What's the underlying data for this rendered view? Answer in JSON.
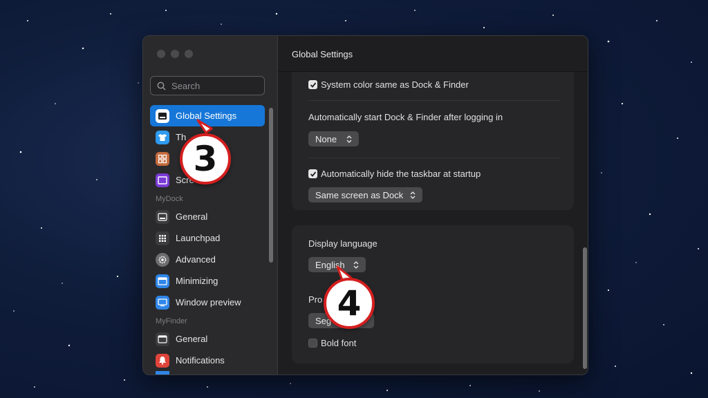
{
  "window": {
    "title": "Global Settings"
  },
  "search": {
    "placeholder": "Search"
  },
  "sidebar": {
    "items_top": [
      {
        "label": "Global Settings",
        "icon": "display-icon",
        "color": "#ffffff",
        "active": true
      },
      {
        "label": "Th",
        "icon": "tshirt-icon",
        "color": "#2f9bf0"
      },
      {
        "label": "",
        "icon": "grid-icon",
        "color": "#c46a3c"
      },
      {
        "label": "Scre",
        "icon": "screen-icon",
        "color": "#7a3ad6"
      }
    ],
    "section_mydock": "MyDock",
    "items_mydock": [
      {
        "label": "General",
        "icon": "dock-icon",
        "color": "#3c3c3e"
      },
      {
        "label": "Launchpad",
        "icon": "launchpad-icon",
        "color": "#3c3c3e"
      },
      {
        "label": "Advanced",
        "icon": "gear-icon",
        "color": "#6e6e70"
      },
      {
        "label": "Minimizing",
        "icon": "minimize-icon",
        "color": "#2f86e8"
      },
      {
        "label": "Window preview",
        "icon": "preview-icon",
        "color": "#2f86e8"
      }
    ],
    "section_myfinder": "MyFinder",
    "items_myfinder": [
      {
        "label": "General",
        "icon": "finder-general-icon",
        "color": "#3c3c3e"
      },
      {
        "label": "Notifications",
        "icon": "bell-icon",
        "color": "#e0443a"
      }
    ]
  },
  "settings": {
    "system_color_label": "System color same as Dock & Finder",
    "system_color_checked": true,
    "autostart_label": "Automatically start Dock & Finder after logging in",
    "autostart_value": "None",
    "autohide_label": "Automatically hide the taskbar at startup",
    "autohide_checked": true,
    "autohide_screen_value": "Same screen as Dock",
    "display_language_label": "Display language",
    "display_language_value": "English",
    "font_label": "Pro",
    "font_value": "Seg",
    "bold_font_label": "Bold font",
    "bold_font_checked": false
  },
  "annotations": {
    "step_3": "3",
    "step_4": "4",
    "color": "#d51f1f"
  }
}
